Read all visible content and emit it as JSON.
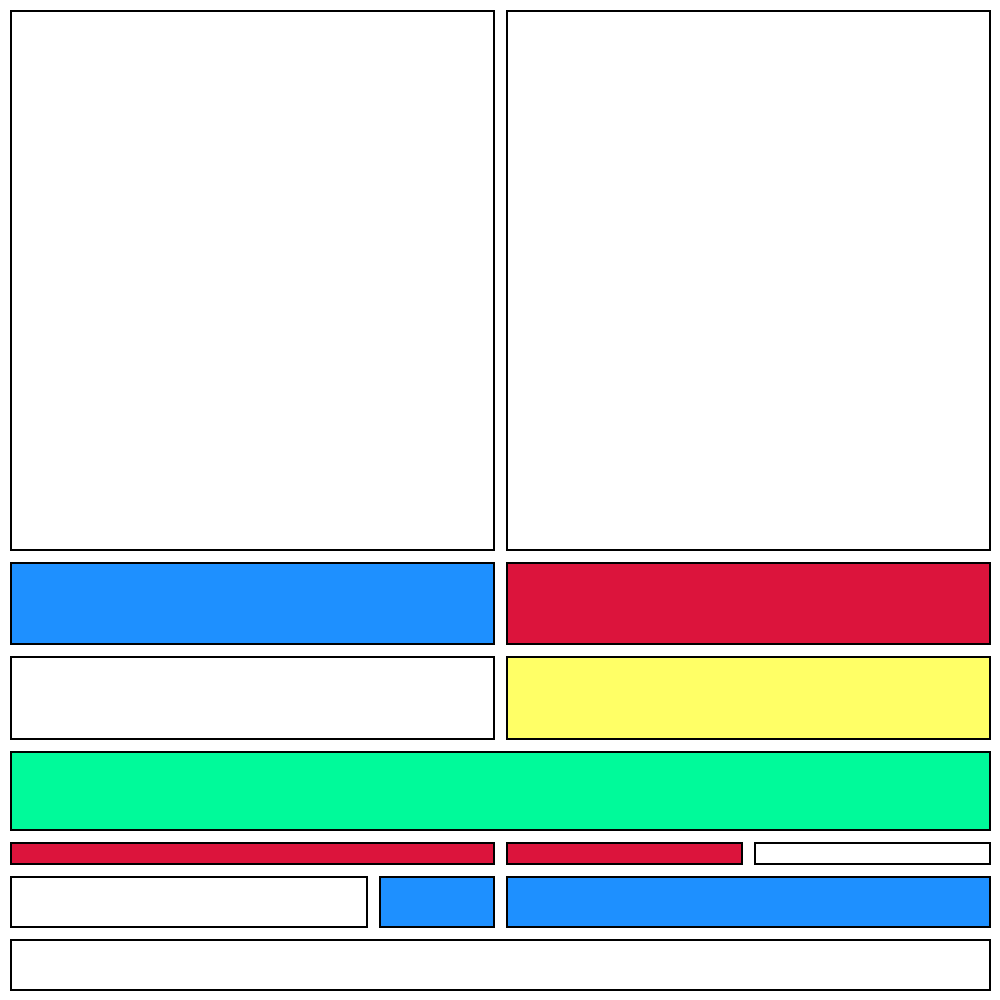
{
  "colors": {
    "white": "#ffffff",
    "blue": "#1e90ff",
    "red": "#dc143c",
    "yellow": "#ffff66",
    "green": "#00fa9a",
    "border": "#000000"
  },
  "panels": [
    {
      "name": "panel-top-left-large",
      "color": "white"
    },
    {
      "name": "panel-top-right-large",
      "color": "white"
    },
    {
      "name": "panel-row2-left",
      "color": "blue"
    },
    {
      "name": "panel-row2-right",
      "color": "red"
    },
    {
      "name": "panel-row3-left",
      "color": "white"
    },
    {
      "name": "panel-row3-right",
      "color": "yellow"
    },
    {
      "name": "panel-row4-full",
      "color": "green"
    },
    {
      "name": "panel-row5-left",
      "color": "red"
    },
    {
      "name": "panel-row5-middle",
      "color": "red"
    },
    {
      "name": "panel-row5-right",
      "color": "white"
    },
    {
      "name": "panel-row6-left",
      "color": "white"
    },
    {
      "name": "panel-row6-middle",
      "color": "blue"
    },
    {
      "name": "panel-row6-right",
      "color": "blue"
    },
    {
      "name": "panel-row7-full",
      "color": "white"
    }
  ]
}
